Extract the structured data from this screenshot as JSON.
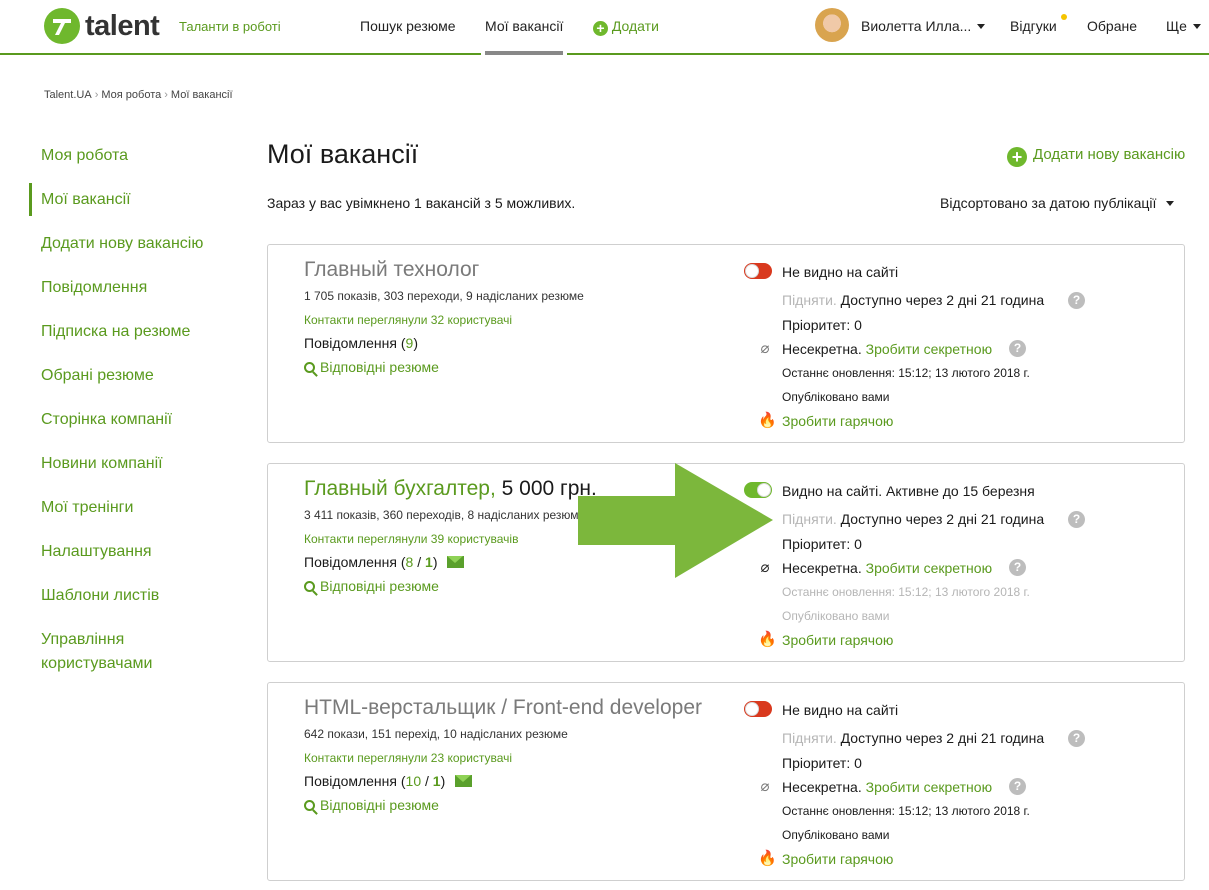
{
  "header": {
    "logo_text": "talent",
    "tagline": "Таланти в роботі",
    "nav": {
      "search": "Пошук резюме",
      "my_vacancies": "Мої вакансії",
      "add": "Додати"
    },
    "user_name": "Виолетта Илла...",
    "responses": "Відгуки",
    "favorites": "Обране",
    "more": "Ще",
    "accent_color": "#5a9a1e"
  },
  "breadcrumb": [
    "Talent.UA",
    "Моя робота",
    "Мої вакансії"
  ],
  "sidebar": {
    "items": [
      {
        "label": "Моя робота"
      },
      {
        "label": "Мої вакансії"
      },
      {
        "label": "Додати нову вакансію"
      },
      {
        "label": "Повідомлення"
      },
      {
        "label": "Підписка на резюме"
      },
      {
        "label": "Обрані резюме"
      },
      {
        "label": "Сторінка компанії"
      },
      {
        "label": "Новини компанії"
      },
      {
        "label": "Мої тренінги"
      },
      {
        "label": "Налаштування"
      },
      {
        "label": "Шаблони листів"
      },
      {
        "label": "Управління"
      },
      {
        "label": "користувачами"
      }
    ]
  },
  "main": {
    "title": "Мої вакансії",
    "add_link": "Додати нову вакансію",
    "summary": "Зараз у вас увімкнено 1 вакансій з 5 можливих.",
    "sort": "Відсортовано за датою публікації"
  },
  "vacancies": [
    {
      "title": "Главный технолог",
      "salary": "",
      "stats": "1 705 показів, 303 переходи, 9 надісланих резюме",
      "contacts": "Контакти переглянули 32 користувачі",
      "messages_label": "Повідомлення",
      "messages_count": "9",
      "messages_new": "",
      "resume_link": "Відповідні резюме",
      "visibility": "Не видно на сайті",
      "raise_label": "Підняти.",
      "raise_available": "Доступно через 2 дні 21 година",
      "priority": "Пріоритет: 0",
      "secret_status": "Несекретна.",
      "make_secret": "Зробити секретною",
      "updated": "Останнє оновлення: 15:12; 13 лютого 2018 г.",
      "published": "Опубліковано вами",
      "make_hot": "Зробити гарячою"
    },
    {
      "title": "Главный бухгалтер,",
      "salary": "5 000 грн.",
      "stats": "3 411 показів, 360 переходів, 8 надісланих резюме",
      "contacts": "Контакти переглянули 39 користувачів",
      "messages_label": "Повідомлення",
      "messages_count": "8",
      "messages_new": "1",
      "resume_link": "Відповідні резюме",
      "visibility": "Видно на сайті. Активне до 15 березня",
      "raise_label": "Підняти.",
      "raise_available": "Доступно через 2 дні 21 година",
      "priority": "Пріоритет: 0",
      "secret_status": "Несекретна.",
      "make_secret": "Зробити секретною",
      "updated": "Останнє оновлення: 15:12; 13 лютого 2018 г.",
      "published": "Опубліковано вами",
      "make_hot": "Зробити гарячою"
    },
    {
      "title": "HTML-верстальщик / Front-end developer",
      "salary": "",
      "stats": "642 покази, 151 перехід, 10 надісланих резюме",
      "contacts": "Контакти переглянули 23 користувачі",
      "messages_label": "Повідомлення",
      "messages_count": "10",
      "messages_new": "1",
      "resume_link": "Відповідні резюме",
      "visibility": "Не видно на сайті",
      "raise_label": "Підняти.",
      "raise_available": "Доступно через 2 дні 21 година",
      "priority": "Пріоритет: 0",
      "secret_status": "Несекретна.",
      "make_secret": "Зробити секретною",
      "updated": "Останнє оновлення: 15:12; 13 лютого 2018 г.",
      "published": "Опубліковано вами",
      "make_hot": "Зробити гарячою"
    }
  ],
  "icons": {
    "help": "?",
    "secret": "secret-off-icon",
    "hot": "fire-icon",
    "mail": "mail-icon",
    "search": "search-icon",
    "arrow_overlay": "arrow-right-icon"
  }
}
